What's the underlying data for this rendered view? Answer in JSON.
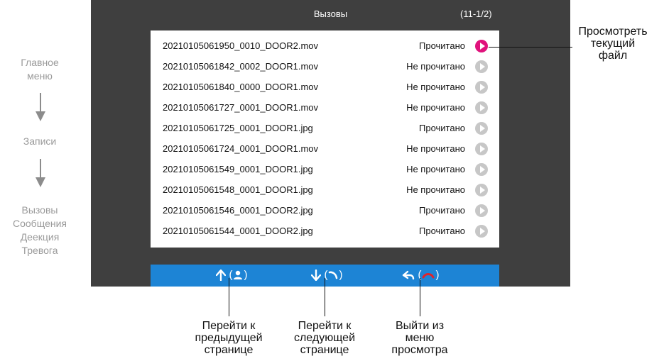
{
  "flow": {
    "step1": [
      "Главное",
      "меню"
    ],
    "step2": "Записи",
    "step3": [
      "Вызовы",
      "Сообщения",
      "Деекция",
      "Тревога"
    ]
  },
  "screen": {
    "title": "Вызовы",
    "page": "(11-1/2)",
    "rows": [
      {
        "file": "20210105061950_0010_DOOR2.mov",
        "status": "Прочитано",
        "selected": true
      },
      {
        "file": "20210105061842_0002_DOOR1.mov",
        "status": "Не прочитано",
        "selected": false
      },
      {
        "file": "20210105061840_0000_DOOR1.mov",
        "status": "Не прочитано",
        "selected": false
      },
      {
        "file": "20210105061727_0001_DOOR1.mov",
        "status": "Не прочитано",
        "selected": false
      },
      {
        "file": "20210105061725_0001_DOOR1.jpg",
        "status": "Прочитано",
        "selected": false
      },
      {
        "file": "20210105061724_0001_DOOR1.mov",
        "status": "Не прочитано",
        "selected": false
      },
      {
        "file": "20210105061549_0001_DOOR1.jpg",
        "status": "Не прочитано",
        "selected": false
      },
      {
        "file": "20210105061548_0001_DOOR1.jpg",
        "status": "Не прочитано",
        "selected": false
      },
      {
        "file": "20210105061546_0001_DOOR2.jpg",
        "status": "Прочитано",
        "selected": false
      },
      {
        "file": "20210105061544_0001_DOOR2.jpg",
        "status": "Прочитано",
        "selected": false
      }
    ],
    "controls": {
      "prev": {
        "open": "(",
        "close": ")",
        "icons": [
          "arrow-up-icon",
          "person-icon"
        ]
      },
      "next": {
        "open": "(",
        "close": ")",
        "icons": [
          "arrow-down-icon",
          "call-icon"
        ]
      },
      "exit": {
        "open": "(",
        "close": ")",
        "icons": [
          "back-arrow-icon",
          "hang-up-icon"
        ]
      }
    }
  },
  "annotations": {
    "view_file": [
      "Просмотреть",
      "текущий",
      "файл"
    ],
    "prev_page": [
      "Перейти к",
      "предыдущей",
      "странице"
    ],
    "next_page": [
      "Перейти к",
      "следующей",
      "странице"
    ],
    "exit_view": [
      "Выйти из",
      "меню",
      "просмотра"
    ]
  },
  "colors": {
    "screen_bg": "#3f3f3f",
    "bar_bg": "#1d84d5",
    "play_active": "#e0127c",
    "play_inactive": "#c7c7c7",
    "hangup_red": "#e0242b"
  }
}
